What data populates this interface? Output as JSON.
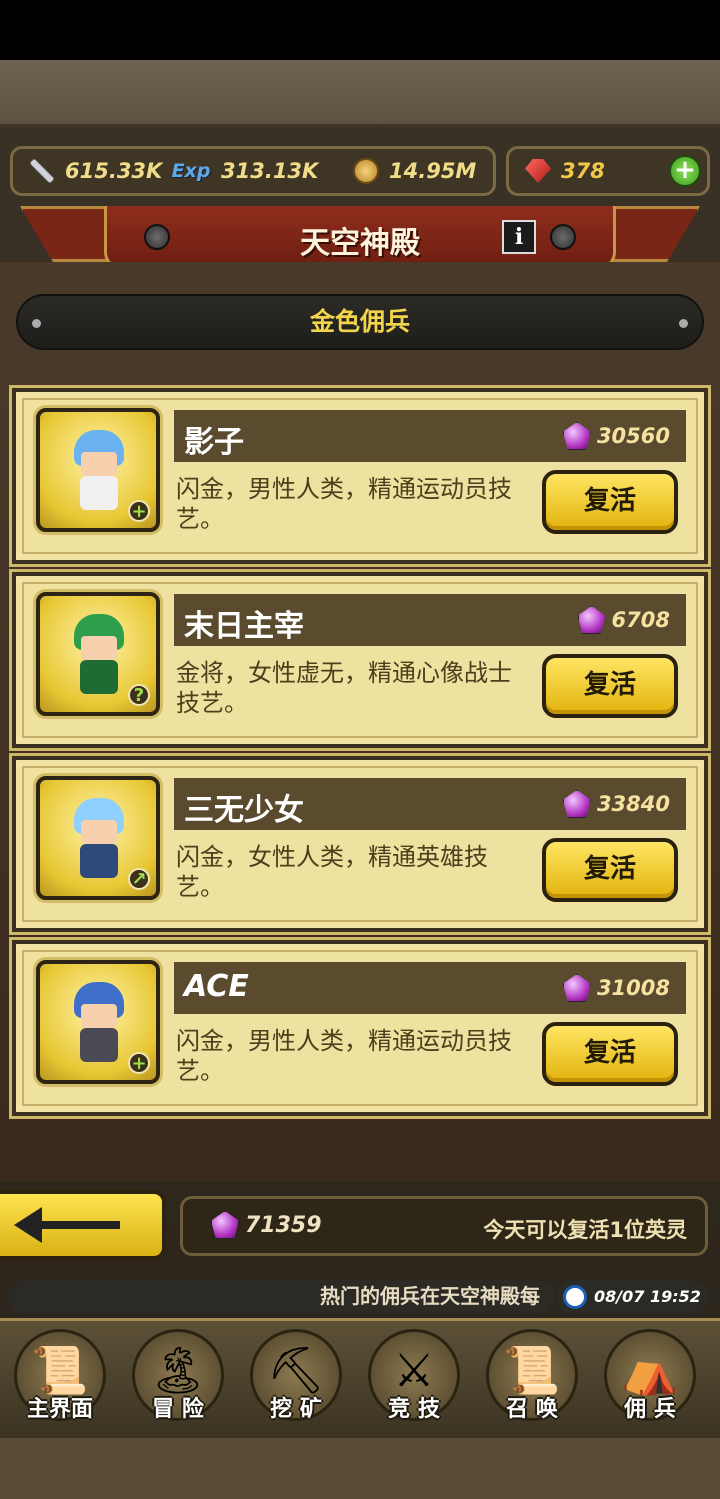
{
  "resources": {
    "attack": "615.33K",
    "exp_label": "Exp",
    "exp": "313.13K",
    "gold": "14.95M",
    "ruby": "378"
  },
  "banner": {
    "title": "天空神殿",
    "info": "i"
  },
  "subtitle": "金色佣兵",
  "mercenaries": [
    {
      "name": "影子",
      "cost": "30560",
      "desc": "闪金，男性人类，精通运动员技艺。",
      "action": "复活",
      "badge": "+",
      "hair": "#6ab3f0",
      "outfit": "#f0f0f0"
    },
    {
      "name": "末日主宰",
      "cost": "6708",
      "desc": "金将，女性虚无，精通心像战士技艺。",
      "action": "复活",
      "badge": "?",
      "hair": "#2e9e4a",
      "outfit": "#1f6b34"
    },
    {
      "name": "三无少女",
      "cost": "33840",
      "desc": "闪金，女性人类，精通英雄技艺。",
      "action": "复活",
      "badge": "↗",
      "hair": "#8fd0ff",
      "outfit": "#2d4a7a"
    },
    {
      "name": "ACE",
      "cost": "31008",
      "desc": "闪金，男性人类，精通运动员技艺。",
      "action": "复活",
      "badge": "+",
      "hair": "#3f6fc9",
      "outfit": "#4a4a55"
    }
  ],
  "bottom": {
    "gems": "71359",
    "note": "今天可以复活1位英灵"
  },
  "ticker": "热门的佣兵在天空神殿每",
  "clock": "08/07 19:52",
  "nav": [
    {
      "label": "主界面",
      "glyph": "📜"
    },
    {
      "label": "冒 险",
      "glyph": "🏝"
    },
    {
      "label": "挖 矿",
      "glyph": "⛏"
    },
    {
      "label": "竞 技",
      "glyph": "⚔"
    },
    {
      "label": "召 唤",
      "glyph": "📜"
    },
    {
      "label": "佣 兵",
      "glyph": "⛺"
    }
  ]
}
